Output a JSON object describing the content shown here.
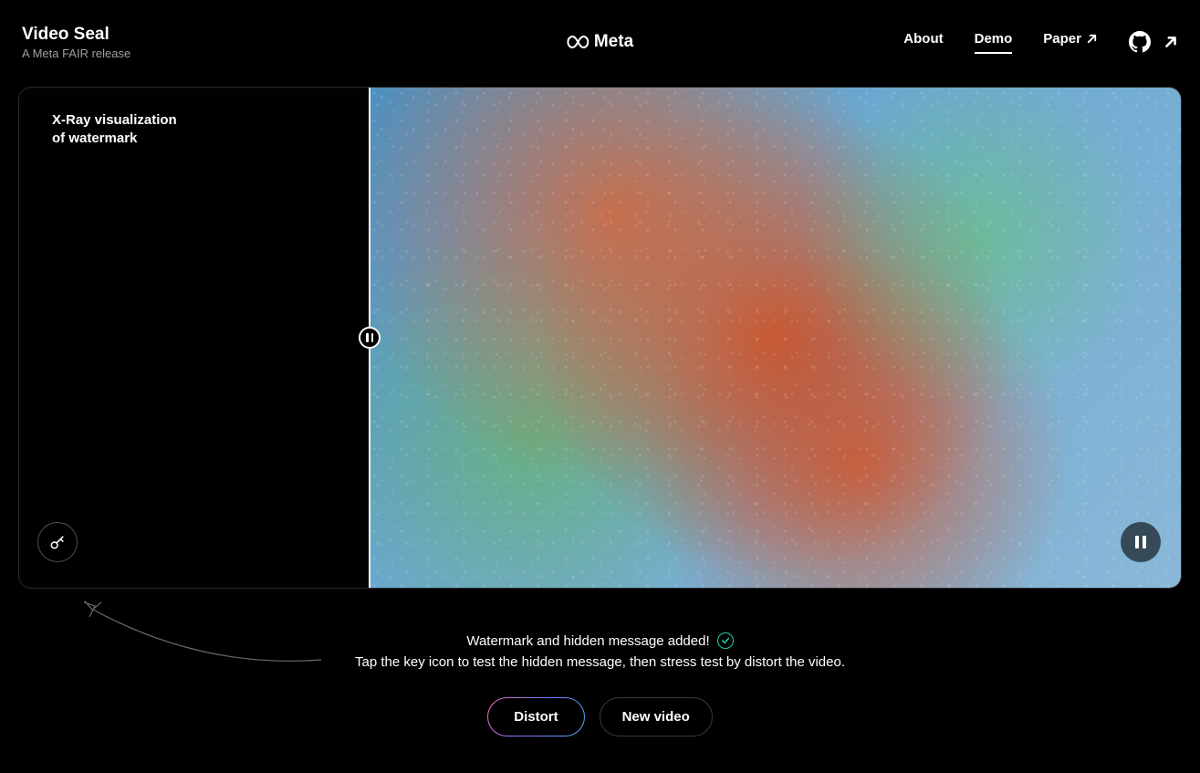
{
  "header": {
    "title": "Video Seal",
    "subtitle": "A Meta FAIR release",
    "logo_text": "Meta",
    "nav": {
      "about": "About",
      "demo": "Demo",
      "paper": "Paper"
    }
  },
  "video": {
    "xray_label_line1": "X-Ray visualization",
    "xray_label_line2": "of watermark"
  },
  "messages": {
    "status": "Watermark and hidden message added!",
    "instruction": "Tap the key icon to test the hidden message, then stress test by distort the video."
  },
  "buttons": {
    "distort": "Distort",
    "new_video": "New video"
  },
  "colors": {
    "accent_teal": "#1fcfb0",
    "gradient_pink": "#ff6ec4",
    "gradient_purple": "#7873f5",
    "gradient_blue": "#4facfe"
  }
}
